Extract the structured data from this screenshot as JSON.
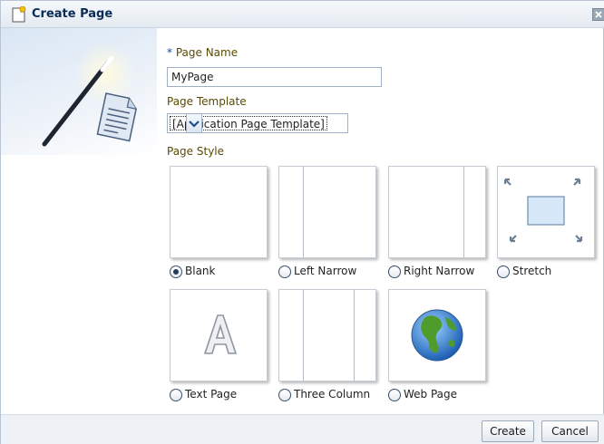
{
  "dialog": {
    "title": "Create Page",
    "title_icon": "create-page-icon",
    "close_icon": "close-icon"
  },
  "form": {
    "page_name": {
      "required_marker": "*",
      "label": "Page Name",
      "value": "MyPage"
    },
    "page_template": {
      "label": "Page Template",
      "selected": "[Application Page Template]"
    },
    "page_style": {
      "label": "Page Style",
      "selected": "Blank",
      "options": [
        {
          "label": "Blank",
          "preview": "blank"
        },
        {
          "label": "Left Narrow",
          "preview": "left-narrow"
        },
        {
          "label": "Right Narrow",
          "preview": "right-narrow"
        },
        {
          "label": "Stretch",
          "preview": "stretch"
        },
        {
          "label": "Text Page",
          "preview": "text-page"
        },
        {
          "label": "Three Column",
          "preview": "three-column"
        },
        {
          "label": "Web Page",
          "preview": "web-page"
        }
      ]
    }
  },
  "buttons": {
    "create": "Create",
    "cancel": "Cancel"
  },
  "colors": {
    "title_text": "#0a2b55",
    "label_text": "#5a4a00",
    "required_marker": "#0b4fa8",
    "footer_bg": "#eef2f6"
  }
}
